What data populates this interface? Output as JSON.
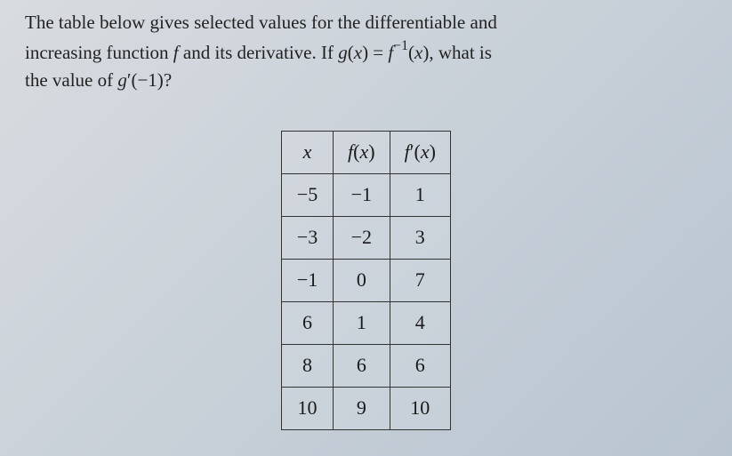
{
  "question": {
    "line1_part1": "The table below gives selected values for the differentiable and",
    "line2_part1": "increasing function ",
    "line2_fvar": "f",
    "line2_part2": " and its derivative. If ",
    "line2_gx": "g",
    "line2_paren1": "(",
    "line2_x1": "x",
    "line2_paren2": ") = ",
    "line2_f": "f",
    "line2_inv": "−1",
    "line2_paren3": "(",
    "line2_x2": "x",
    "line2_paren4": ")",
    "line2_part3": ", what is",
    "line3_part1": "the value of ",
    "line3_g": "g",
    "line3_prime": "′",
    "line3_paren1": "(−1)",
    "line3_part2": "?"
  },
  "table": {
    "headers": {
      "col1": "x",
      "col2_f": "f",
      "col2_paren": "(",
      "col2_x": "x",
      "col2_close": ")",
      "col3_f": "f",
      "col3_prime": "′",
      "col3_paren": "(",
      "col3_x": "x",
      "col3_close": ")"
    },
    "rows": [
      {
        "x": "−5",
        "fx": "−1",
        "fpx": "1"
      },
      {
        "x": "−3",
        "fx": "−2",
        "fpx": "3"
      },
      {
        "x": "−1",
        "fx": "0",
        "fpx": "7"
      },
      {
        "x": "6",
        "fx": "1",
        "fpx": "4"
      },
      {
        "x": "8",
        "fx": "6",
        "fpx": "6"
      },
      {
        "x": "10",
        "fx": "9",
        "fpx": "10"
      }
    ]
  }
}
